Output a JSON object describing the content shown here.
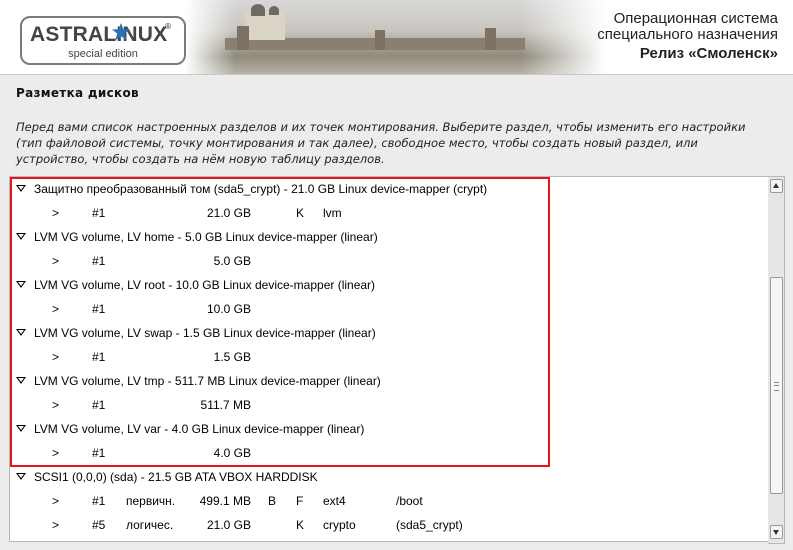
{
  "header": {
    "logo_text": "ASTRALINUX",
    "logo_reg": "®",
    "logo_sub": "special edition",
    "os_line1": "Операционная система",
    "os_line2": "специального назначения",
    "release": "Релиз «Смоленск»"
  },
  "page_title": "Разметка дисков",
  "intro_lines": [
    "Перед вами список настроенных разделов и их точек монтирования. Выберите раздел, чтобы изменить его настройки",
    "(тип файловой системы, точку монтирования и так далее), свободное место, чтобы создать новый раздел, или",
    "устройство, чтобы создать на нём новую таблицу разделов."
  ],
  "groups": [
    {
      "label": "Защитно преобразованный том (sda5_crypt) - 21.0 GB Linux device-mapper (crypt)",
      "partitions": [
        {
          "arrow": ">",
          "num": "#1",
          "type": "",
          "size": "21.0 GB",
          "b": "",
          "f": "K",
          "fs": "lvm",
          "mount": ""
        }
      ]
    },
    {
      "label": "LVM VG volume, LV home - 5.0 GB Linux device-mapper (linear)",
      "partitions": [
        {
          "arrow": ">",
          "num": "#1",
          "type": "",
          "size": "5.0 GB",
          "b": "",
          "f": "",
          "fs": "",
          "mount": ""
        }
      ]
    },
    {
      "label": "LVM VG volume, LV root - 10.0 GB Linux device-mapper (linear)",
      "partitions": [
        {
          "arrow": ">",
          "num": "#1",
          "type": "",
          "size": "10.0 GB",
          "b": "",
          "f": "",
          "fs": "",
          "mount": ""
        }
      ]
    },
    {
      "label": "LVM VG volume, LV swap - 1.5 GB Linux device-mapper (linear)",
      "partitions": [
        {
          "arrow": ">",
          "num": "#1",
          "type": "",
          "size": "1.5 GB",
          "b": "",
          "f": "",
          "fs": "",
          "mount": ""
        }
      ]
    },
    {
      "label": "LVM VG volume, LV tmp - 511.7 MB Linux device-mapper (linear)",
      "partitions": [
        {
          "arrow": ">",
          "num": "#1",
          "type": "",
          "size": "511.7 MB",
          "b": "",
          "f": "",
          "fs": "",
          "mount": ""
        }
      ]
    },
    {
      "label": "LVM VG volume, LV var - 4.0 GB Linux device-mapper (linear)",
      "partitions": [
        {
          "arrow": ">",
          "num": "#1",
          "type": "",
          "size": "4.0 GB",
          "b": "",
          "f": "",
          "fs": "",
          "mount": ""
        }
      ]
    },
    {
      "label": "SCSI1 (0,0,0) (sda) - 21.5 GB ATA VBOX HARDDISK",
      "partitions": [
        {
          "arrow": ">",
          "num": "#1",
          "type": "первичн.",
          "size": "499.1 MB",
          "b": "B",
          "f": "F",
          "fs": "ext4",
          "mount": "/boot"
        },
        {
          "arrow": ">",
          "num": "#5",
          "type": "логичес.",
          "size": "21.0 GB",
          "b": "",
          "f": "K",
          "fs": "crypto",
          "mount": "(sda5_crypt)"
        }
      ]
    }
  ],
  "colors": {
    "highlight": "#e8121c",
    "background": "#ececec",
    "list_background": "#ffffff"
  },
  "icons": {
    "expand": "triangle-down-icon",
    "partition_marker": ">",
    "logo_star": "star-icon"
  }
}
